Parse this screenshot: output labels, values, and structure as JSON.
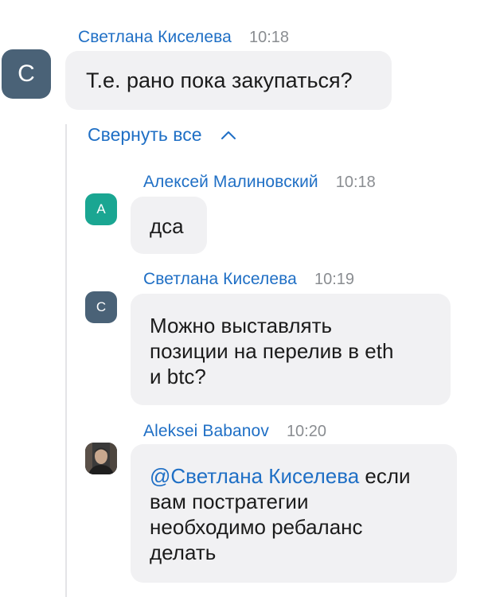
{
  "root_message": {
    "author": "Светлана Киселева",
    "time": "10:18",
    "avatar_letter": "С",
    "text": "Т.е. рано пока закупаться?"
  },
  "thread": {
    "collapse_label": "Свернуть все",
    "collapse_icon": "chevron-up-icon",
    "replies": [
      {
        "author": "Алексей Малиновский",
        "time": "10:18",
        "avatar_letter": "А",
        "avatar_color": "#1aa692",
        "text": "дса"
      },
      {
        "author": "Светлана Киселева",
        "time": "10:19",
        "avatar_letter": "С",
        "avatar_color": "#4a6277",
        "lines": [
          "Можно выставлять",
          "позиции на перелив в eth",
          "и btc?"
        ]
      },
      {
        "author": "Aleksei Babanov",
        "time": "10:20",
        "avatar_type": "photo",
        "mention": "@Светлана Киселева",
        "lines": [
          " если",
          "вам постратегии",
          "необходимо ребаланс",
          "делать"
        ]
      }
    ]
  },
  "colors": {
    "link": "#1f6fc5",
    "timestamp": "#8a8d91",
    "bubble": "#f1f1f3"
  }
}
